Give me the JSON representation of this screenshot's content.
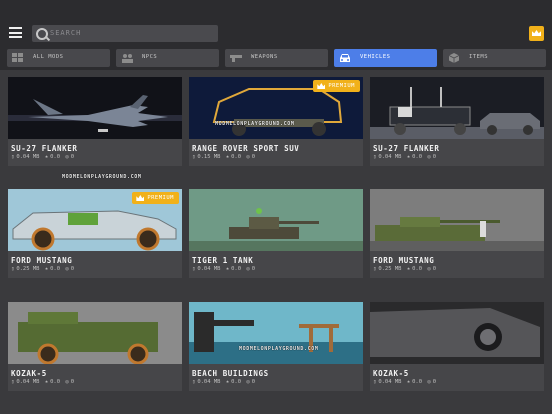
{
  "search": {
    "placeholder": "SEARCH"
  },
  "tabs": [
    {
      "label": "ALL MODS",
      "icon": "grid-icon",
      "active": false
    },
    {
      "label": "NPCS",
      "icon": "people-icon",
      "active": false
    },
    {
      "label": "WEAPONS",
      "icon": "gun-icon",
      "active": false
    },
    {
      "label": "VEHICLES",
      "icon": "car-icon",
      "active": true
    },
    {
      "label": "ITEMS",
      "icon": "box-icon",
      "active": false
    }
  ],
  "premium_label": "PREMIUM",
  "watermark": "MODMELONPLAYGROUND.COM",
  "cards": [
    {
      "title": "SU-27 FLANKER",
      "size": "0.04 MB",
      "rating": "0.0",
      "comments": "0",
      "premium": false
    },
    {
      "title": "RANGE ROVER SPORT SUV",
      "size": "0.15 MB",
      "rating": "0.0",
      "comments": "0",
      "premium": true
    },
    {
      "title": "SU-27 FLANKER",
      "size": "0.04 MB",
      "rating": "0.0",
      "comments": "0",
      "premium": false
    },
    {
      "title": "FORD MUSTANG",
      "size": "0.25 MB",
      "rating": "0.0",
      "comments": "0",
      "premium": true
    },
    {
      "title": "TIGER 1 TANK",
      "size": "0.04 MB",
      "rating": "0.0",
      "comments": "0",
      "premium": false
    },
    {
      "title": "FORD MUSTANG",
      "size": "0.25 MB",
      "rating": "0.0",
      "comments": "0",
      "premium": false
    },
    {
      "title": "KOZAK-5",
      "size": "0.04 MB",
      "rating": "0.0",
      "comments": "0",
      "premium": false
    },
    {
      "title": "BEACH BUILDINGS",
      "size": "0.04 MB",
      "rating": "0.0",
      "comments": "0",
      "premium": false
    },
    {
      "title": "KOZAK-5",
      "size": "0.04 MB",
      "rating": "0.0",
      "comments": "0",
      "premium": false
    }
  ],
  "colors": {
    "accent": "#4d7ee8",
    "premium": "#f1b11a",
    "background": "#3a3a3d"
  }
}
